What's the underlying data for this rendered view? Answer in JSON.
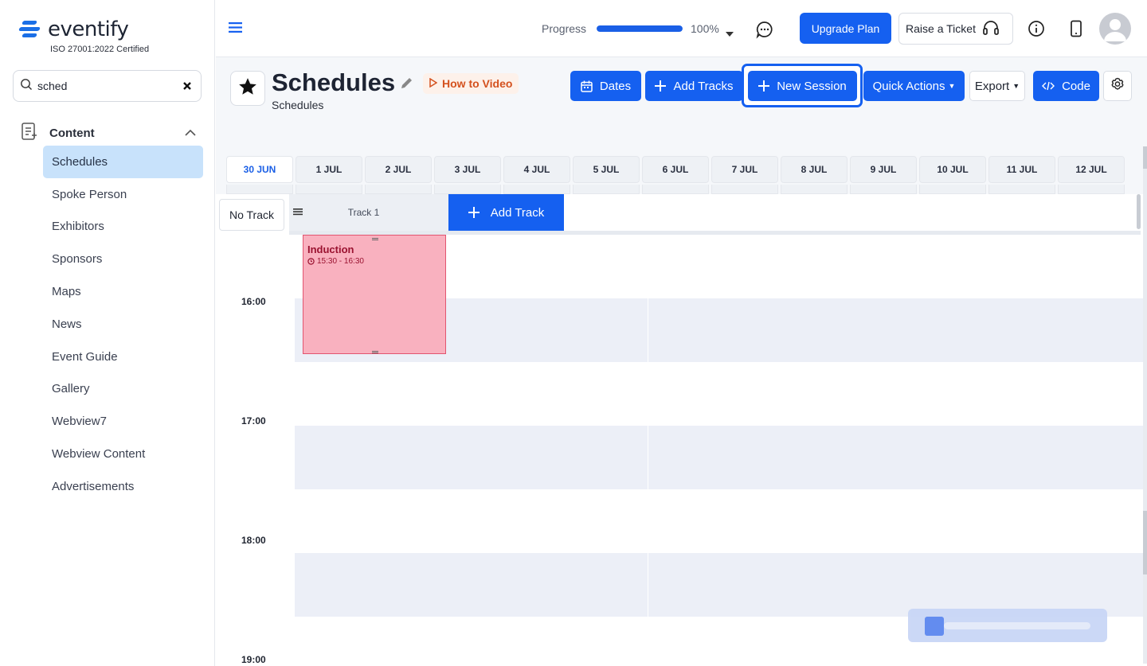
{
  "brand": {
    "name": "eventify",
    "certification": "ISO 27001:2022 Certified",
    "accent_color": "#1560f0"
  },
  "sidebar": {
    "search": {
      "value": "sched",
      "placeholder": ""
    },
    "section": {
      "label": "Content"
    },
    "items": [
      {
        "label": "Schedules",
        "active": true
      },
      {
        "label": "Spoke Person"
      },
      {
        "label": "Exhibitors"
      },
      {
        "label": "Sponsors"
      },
      {
        "label": "Maps"
      },
      {
        "label": "News"
      },
      {
        "label": "Event Guide"
      },
      {
        "label": "Gallery"
      },
      {
        "label": "Webview7"
      },
      {
        "label": "Webview Content"
      },
      {
        "label": "Advertisements"
      }
    ]
  },
  "topbar": {
    "progress_label": "Progress",
    "progress_value": 1.0,
    "progress_text": "100%",
    "upgrade_label": "Upgrade Plan",
    "ticket_label": "Raise a Ticket"
  },
  "page": {
    "title": "Schedules",
    "subtitle": "Schedules",
    "how_to_label": "How to Video"
  },
  "actions": {
    "dates": "Dates",
    "add_tracks": "Add Tracks",
    "new_session": "New Session",
    "quick_actions": "Quick Actions",
    "export": "Export",
    "code": "Code"
  },
  "dates": [
    "30 JUN",
    "1 JUL",
    "2 JUL",
    "3 JUL",
    "4 JUL",
    "5 JUL",
    "6 JUL",
    "7 JUL",
    "8 JUL",
    "9 JUL",
    "10 JUL",
    "11 JUL",
    "12 JUL"
  ],
  "active_date_index": 0,
  "schedule": {
    "no_track_label": "No Track",
    "track_name": "Track 1",
    "add_track_label": "Add Track",
    "times": [
      "16:00",
      "17:00",
      "18:00",
      "19:00"
    ],
    "event": {
      "title": "Induction",
      "time": "15:30 - 16:30",
      "color": "#f9b1bf"
    }
  }
}
